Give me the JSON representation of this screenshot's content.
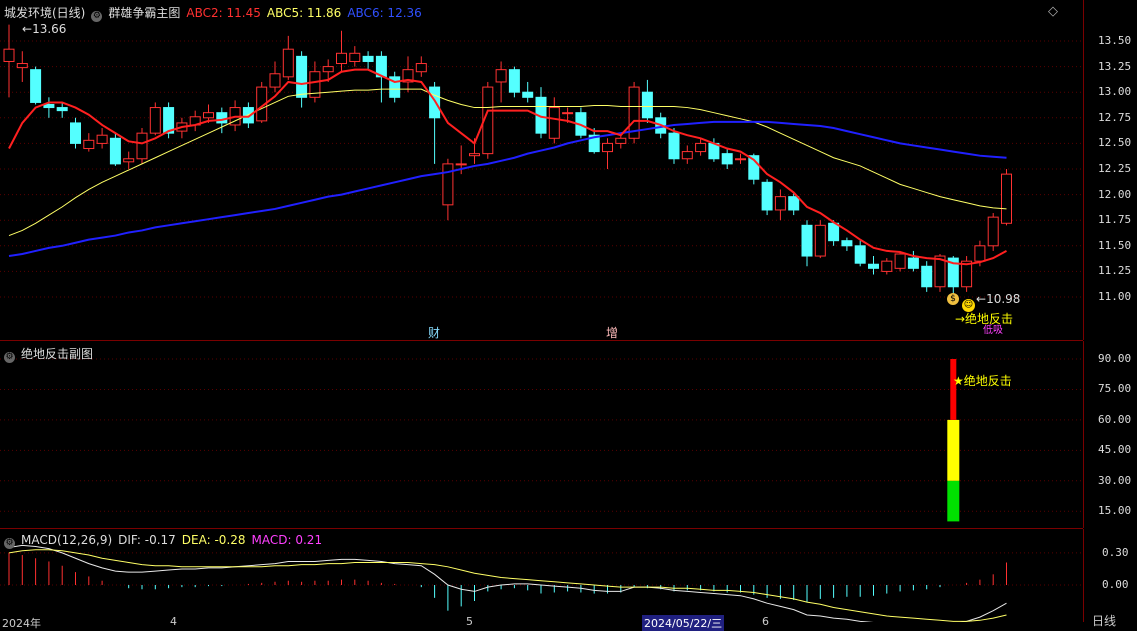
{
  "main": {
    "stock_title": "城发环境(日线)",
    "indicator_name": "群雄争霸主图",
    "abc2_label": "ABC2: 11.45",
    "abc5_label": "ABC5: 11.86",
    "abc6_label": "ABC6: 12.36",
    "high_marker": "13.66",
    "low_marker": "10.98",
    "signal_text": "→绝地反击",
    "signal_sub": "低吸",
    "event_cai": "财",
    "event_zeng": "增",
    "y_ticks": [
      "13.50",
      "13.25",
      "13.00",
      "12.75",
      "12.50",
      "12.25",
      "12.00",
      "11.75",
      "11.50",
      "11.25",
      "11.00"
    ],
    "colors": {
      "up": "#ff3232",
      "down": "#54ffff",
      "abc2": "#ff2020",
      "abc5": "#ffff66",
      "abc6": "#2020ff"
    }
  },
  "sub": {
    "title": "绝地反击副图",
    "star_label": "★绝地反击",
    "y_ticks": [
      "90.00",
      "75.00",
      "60.00",
      "45.00",
      "30.00",
      "15.00"
    ]
  },
  "macd": {
    "title": "MACD(12,26,9)",
    "dif_label": "DIF: -0.17",
    "dea_label": "DEA: -0.28",
    "macd_label": "MACD: 0.21",
    "y_ticks": [
      "0.30",
      "0.00"
    ]
  },
  "bottom_axis": {
    "labels": [
      "2024年",
      "4",
      "5",
      "2024/05/22/三",
      "6"
    ],
    "period": "日线"
  },
  "chart_data": {
    "type": "candlestick",
    "candles": [
      [
        13.3,
        13.42,
        13.66,
        12.95
      ],
      [
        13.24,
        13.28,
        13.4,
        13.1
      ],
      [
        13.22,
        12.9,
        13.25,
        12.88
      ],
      [
        12.88,
        12.85,
        12.95,
        12.75
      ],
      [
        12.85,
        12.82,
        12.9,
        12.75
      ],
      [
        12.7,
        12.5,
        12.75,
        12.45
      ],
      [
        12.45,
        12.53,
        12.6,
        12.42
      ],
      [
        12.5,
        12.58,
        12.65,
        12.45
      ],
      [
        12.55,
        12.3,
        12.6,
        12.28
      ],
      [
        12.32,
        12.35,
        12.42,
        12.25
      ],
      [
        12.35,
        12.6,
        12.65,
        12.3
      ],
      [
        12.6,
        12.85,
        12.9,
        12.58
      ],
      [
        12.85,
        12.6,
        12.9,
        12.55
      ],
      [
        12.62,
        12.7,
        12.75,
        12.55
      ],
      [
        12.68,
        12.76,
        12.82,
        12.62
      ],
      [
        12.75,
        12.8,
        12.88,
        12.7
      ],
      [
        12.8,
        12.7,
        12.85,
        12.6
      ],
      [
        12.68,
        12.85,
        12.92,
        12.62
      ],
      [
        12.85,
        12.7,
        12.9,
        12.65
      ],
      [
        12.72,
        13.05,
        13.1,
        12.7
      ],
      [
        13.05,
        13.18,
        13.3,
        13.0
      ],
      [
        13.15,
        13.42,
        13.55,
        13.12
      ],
      [
        13.35,
        12.95,
        13.4,
        12.85
      ],
      [
        12.95,
        13.2,
        13.3,
        12.9
      ],
      [
        13.2,
        13.25,
        13.32,
        13.1
      ],
      [
        13.28,
        13.38,
        13.6,
        13.2
      ],
      [
        13.3,
        13.38,
        13.45,
        13.25
      ],
      [
        13.35,
        13.3,
        13.4,
        13.22
      ],
      [
        13.35,
        13.15,
        13.4,
        12.9
      ],
      [
        13.15,
        12.95,
        13.2,
        12.9
      ],
      [
        13.1,
        13.22,
        13.35,
        13.0
      ],
      [
        13.2,
        13.28,
        13.35,
        13.15
      ],
      [
        13.05,
        12.75,
        13.1,
        12.3
      ],
      [
        11.9,
        12.3,
        12.35,
        11.75
      ],
      [
        12.3,
        12.3,
        12.48,
        12.2
      ],
      [
        12.38,
        12.4,
        12.55,
        12.3
      ],
      [
        12.4,
        13.05,
        13.1,
        12.35
      ],
      [
        13.1,
        13.22,
        13.3,
        12.9
      ],
      [
        13.22,
        13.0,
        13.25,
        12.95
      ],
      [
        13.0,
        12.95,
        13.1,
        12.9
      ],
      [
        12.95,
        12.6,
        13.05,
        12.55
      ],
      [
        12.55,
        12.85,
        12.95,
        12.5
      ],
      [
        12.8,
        12.8,
        12.85,
        12.7
      ],
      [
        12.8,
        12.58,
        12.85,
        12.55
      ],
      [
        12.58,
        12.42,
        12.65,
        12.4
      ],
      [
        12.42,
        12.5,
        12.55,
        12.25
      ],
      [
        12.5,
        12.55,
        12.58,
        12.45
      ],
      [
        12.55,
        13.05,
        13.1,
        12.5
      ],
      [
        13.0,
        12.75,
        13.12,
        12.7
      ],
      [
        12.75,
        12.6,
        12.8,
        12.55
      ],
      [
        12.6,
        12.35,
        12.65,
        12.3
      ],
      [
        12.35,
        12.42,
        12.48,
        12.3
      ],
      [
        12.42,
        12.5,
        12.55,
        12.38
      ],
      [
        12.5,
        12.35,
        12.55,
        12.32
      ],
      [
        12.4,
        12.3,
        12.45,
        12.25
      ],
      [
        12.35,
        12.35,
        12.4,
        12.3
      ],
      [
        12.38,
        12.15,
        12.4,
        12.1
      ],
      [
        12.12,
        11.85,
        12.15,
        11.8
      ],
      [
        11.85,
        11.98,
        12.05,
        11.75
      ],
      [
        11.98,
        11.85,
        12.02,
        11.8
      ],
      [
        11.7,
        11.4,
        11.75,
        11.3
      ],
      [
        11.4,
        11.7,
        11.75,
        11.38
      ],
      [
        11.72,
        11.55,
        11.75,
        11.5
      ],
      [
        11.55,
        11.5,
        11.58,
        11.45
      ],
      [
        11.5,
        11.33,
        11.55,
        11.3
      ],
      [
        11.32,
        11.28,
        11.4,
        11.22
      ],
      [
        11.25,
        11.35,
        11.38,
        11.22
      ],
      [
        11.28,
        11.42,
        11.45,
        11.25
      ],
      [
        11.38,
        11.28,
        11.45,
        11.25
      ],
      [
        11.3,
        11.1,
        11.35,
        11.05
      ],
      [
        11.1,
        11.4,
        11.42,
        11.05
      ],
      [
        11.38,
        11.1,
        11.4,
        10.98
      ],
      [
        11.1,
        11.35,
        11.4,
        11.05
      ],
      [
        11.35,
        11.5,
        11.55,
        11.3
      ],
      [
        11.5,
        11.78,
        11.82,
        11.45
      ],
      [
        11.72,
        12.2,
        12.25,
        11.7
      ]
    ],
    "abc2": [
      12.45,
      12.7,
      12.85,
      12.9,
      12.9,
      12.85,
      12.78,
      12.68,
      12.6,
      12.52,
      12.5,
      12.55,
      12.62,
      12.66,
      12.68,
      12.72,
      12.73,
      12.76,
      12.76,
      12.86,
      12.96,
      13.1,
      13.08,
      13.1,
      13.12,
      13.2,
      13.22,
      13.22,
      13.16,
      13.1,
      13.12,
      13.1,
      12.92,
      12.7,
      12.6,
      12.5,
      12.82,
      12.82,
      12.82,
      12.82,
      12.76,
      12.74,
      12.72,
      12.68,
      12.62,
      12.62,
      12.58,
      12.72,
      12.72,
      12.68,
      12.62,
      12.58,
      12.55,
      12.5,
      12.45,
      12.42,
      12.34,
      12.2,
      12.12,
      12.02,
      11.88,
      11.82,
      11.73,
      11.65,
      11.56,
      11.48,
      11.45,
      11.44,
      11.4,
      11.38,
      11.37,
      11.33,
      11.32,
      11.34,
      11.38,
      11.45
    ],
    "abc5": [
      11.6,
      11.65,
      11.72,
      11.8,
      11.88,
      11.97,
      12.05,
      12.12,
      12.18,
      12.24,
      12.3,
      12.36,
      12.42,
      12.48,
      12.54,
      12.6,
      12.66,
      12.72,
      12.78,
      12.84,
      12.9,
      12.96,
      12.98,
      12.99,
      13.0,
      13.01,
      13.02,
      13.02,
      13.03,
      13.03,
      13.03,
      13.03,
      12.97,
      12.92,
      12.88,
      12.85,
      12.85,
      12.86,
      12.86,
      12.86,
      12.86,
      12.86,
      12.86,
      12.86,
      12.87,
      12.87,
      12.86,
      12.86,
      12.86,
      12.86,
      12.86,
      12.85,
      12.83,
      12.8,
      12.77,
      12.74,
      12.71,
      12.66,
      12.6,
      12.54,
      12.48,
      12.42,
      12.36,
      12.32,
      12.28,
      12.22,
      12.16,
      12.1,
      12.06,
      12.02,
      11.98,
      11.95,
      11.92,
      11.89,
      11.87,
      11.86
    ],
    "abc6": [
      11.4,
      11.42,
      11.45,
      11.48,
      11.5,
      11.53,
      11.56,
      11.58,
      11.6,
      11.63,
      11.65,
      11.68,
      11.7,
      11.72,
      11.74,
      11.76,
      11.78,
      11.8,
      11.82,
      11.84,
      11.86,
      11.89,
      11.92,
      11.95,
      11.98,
      12.0,
      12.03,
      12.06,
      12.09,
      12.12,
      12.15,
      12.18,
      12.2,
      12.22,
      12.25,
      12.28,
      12.3,
      12.33,
      12.36,
      12.4,
      12.43,
      12.46,
      12.5,
      12.53,
      12.56,
      12.58,
      12.6,
      12.62,
      12.64,
      12.66,
      12.68,
      12.69,
      12.7,
      12.71,
      12.71,
      12.71,
      12.71,
      12.71,
      12.7,
      12.69,
      12.68,
      12.67,
      12.65,
      12.62,
      12.59,
      12.56,
      12.53,
      12.5,
      12.48,
      12.46,
      12.44,
      12.42,
      12.4,
      12.38,
      12.37,
      12.36
    ],
    "sub_bar": {
      "index": 71,
      "green": 30,
      "yellow": 60,
      "red": 90
    },
    "macd_hist": [
      0.3,
      0.28,
      0.25,
      0.22,
      0.18,
      0.12,
      0.08,
      0.04,
      0.0,
      -0.03,
      -0.04,
      -0.04,
      -0.03,
      -0.02,
      -0.02,
      -0.01,
      -0.01,
      0.0,
      0.01,
      0.02,
      0.03,
      0.04,
      0.03,
      0.04,
      0.04,
      0.05,
      0.05,
      0.04,
      0.02,
      0.01,
      0.0,
      -0.02,
      -0.12,
      -0.24,
      -0.2,
      -0.15,
      -0.06,
      -0.04,
      -0.03,
      -0.05,
      -0.08,
      -0.07,
      -0.06,
      -0.07,
      -0.08,
      -0.08,
      -0.07,
      -0.02,
      -0.03,
      -0.04,
      -0.06,
      -0.05,
      -0.05,
      -0.06,
      -0.07,
      -0.07,
      -0.09,
      -0.12,
      -0.13,
      -0.14,
      -0.16,
      -0.13,
      -0.12,
      -0.11,
      -0.11,
      -0.1,
      -0.08,
      -0.06,
      -0.05,
      -0.04,
      -0.02,
      0.0,
      0.02,
      0.05,
      0.1,
      0.21
    ],
    "dif": [
      0.35,
      0.37,
      0.36,
      0.34,
      0.3,
      0.25,
      0.2,
      0.16,
      0.13,
      0.12,
      0.12,
      0.13,
      0.14,
      0.15,
      0.15,
      0.16,
      0.16,
      0.17,
      0.18,
      0.19,
      0.2,
      0.22,
      0.22,
      0.22,
      0.23,
      0.24,
      0.24,
      0.23,
      0.22,
      0.2,
      0.19,
      0.18,
      0.1,
      0.0,
      -0.04,
      -0.06,
      -0.02,
      0.0,
      0.01,
      0.01,
      0.0,
      -0.01,
      -0.02,
      -0.03,
      -0.05,
      -0.06,
      -0.06,
      -0.02,
      -0.02,
      -0.03,
      -0.05,
      -0.06,
      -0.07,
      -0.08,
      -0.09,
      -0.1,
      -0.13,
      -0.17,
      -0.2,
      -0.23,
      -0.28,
      -0.29,
      -0.31,
      -0.32,
      -0.34,
      -0.35,
      -0.36,
      -0.36,
      -0.37,
      -0.37,
      -0.37,
      -0.36,
      -0.34,
      -0.3,
      -0.24,
      -0.17
    ],
    "dea": [
      0.3,
      0.32,
      0.33,
      0.33,
      0.32,
      0.3,
      0.28,
      0.25,
      0.23,
      0.21,
      0.19,
      0.18,
      0.18,
      0.17,
      0.17,
      0.17,
      0.17,
      0.17,
      0.17,
      0.17,
      0.18,
      0.18,
      0.19,
      0.19,
      0.2,
      0.2,
      0.21,
      0.21,
      0.21,
      0.21,
      0.21,
      0.2,
      0.19,
      0.17,
      0.14,
      0.11,
      0.09,
      0.07,
      0.06,
      0.05,
      0.04,
      0.03,
      0.02,
      0.01,
      0.0,
      -0.01,
      -0.02,
      -0.02,
      -0.02,
      -0.02,
      -0.03,
      -0.03,
      -0.04,
      -0.05,
      -0.05,
      -0.06,
      -0.07,
      -0.09,
      -0.11,
      -0.13,
      -0.16,
      -0.18,
      -0.21,
      -0.23,
      -0.25,
      -0.27,
      -0.29,
      -0.3,
      -0.31,
      -0.32,
      -0.33,
      -0.34,
      -0.34,
      -0.33,
      -0.31,
      -0.28
    ]
  }
}
